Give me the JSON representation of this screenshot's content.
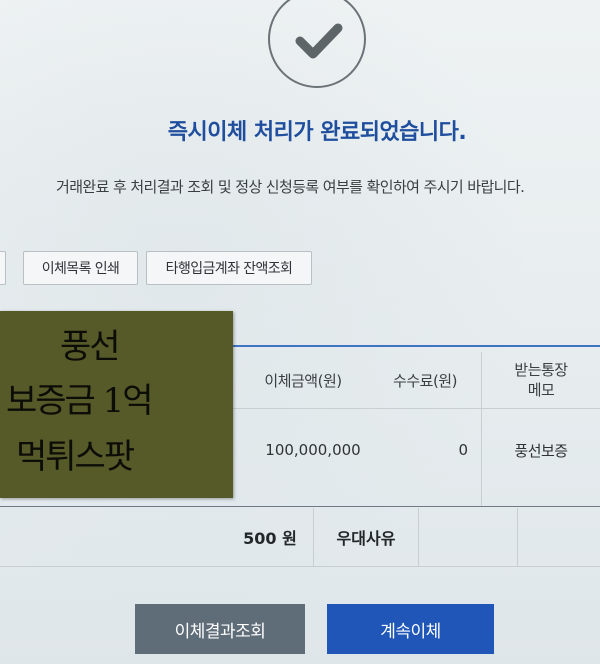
{
  "status": {
    "icon": "check-icon",
    "title": "즉시이체 처리가 완료되었습니다.",
    "subtitle": "거래완료 후 처리결과 조회 및 정상 신청등록 여부를 확인하여 주시기 바랍니다."
  },
  "actions": {
    "print_label": "이체목록 인쇄",
    "balance_label": "타행입금계좌 잔액조회"
  },
  "table": {
    "headers": {
      "amount": "이체금액(원)",
      "fee": "수수료(원)",
      "memo_line1": "받는통장",
      "memo_line2": "메모"
    },
    "row": {
      "amount": "100,000,000",
      "fee": "0",
      "memo": "풍선보증"
    },
    "summary": {
      "fee": "500 원",
      "reason": "우대사유"
    }
  },
  "footer": {
    "query_label": "이체결과조회",
    "continue_label": "계속이체"
  },
  "sticky_note": {
    "lines": [
      "풍선",
      "보증금 1억",
      "먹튀스팟"
    ]
  },
  "colors": {
    "title": "#1f4e9e",
    "primary_button": "#1f56b8",
    "secondary_button": "#5f6d79",
    "table_line": "#3f73c4",
    "sticky_note": "#555a28"
  }
}
